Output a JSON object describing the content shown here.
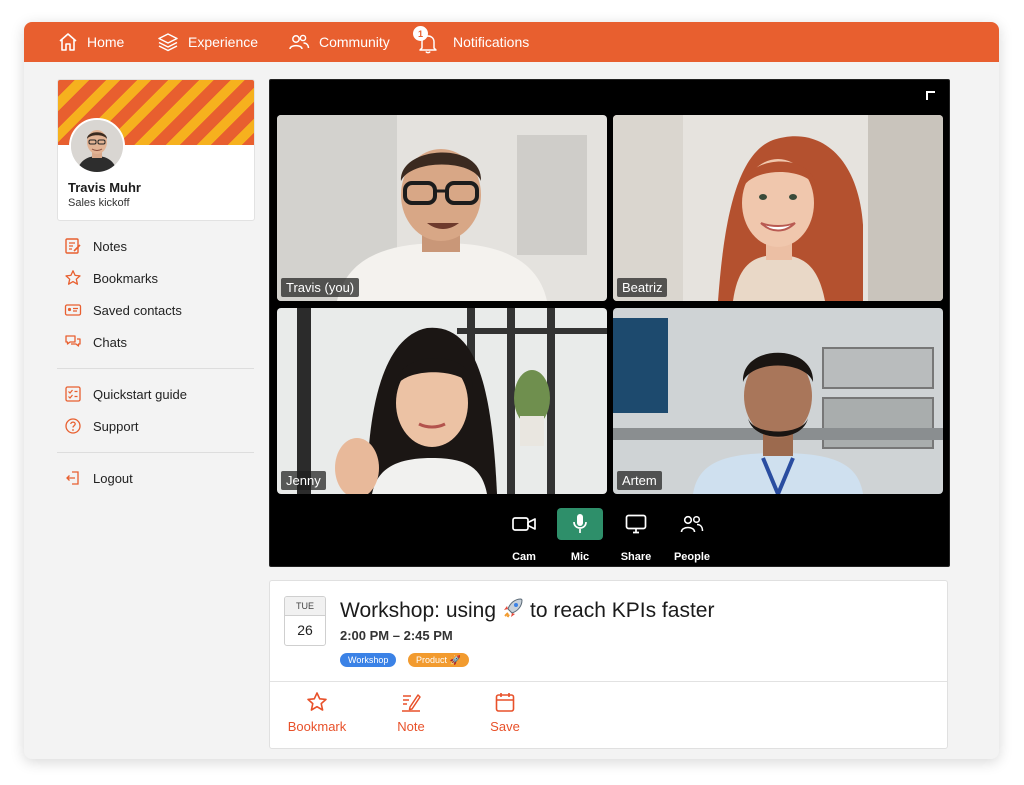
{
  "nav": {
    "items": [
      {
        "label": "Home",
        "icon": "home-icon"
      },
      {
        "label": "Experience",
        "icon": "layers-icon"
      },
      {
        "label": "Community",
        "icon": "people-icon"
      },
      {
        "label": "Notifications",
        "icon": "bell-icon",
        "badge": "1"
      }
    ]
  },
  "profile": {
    "name": "Travis Muhr",
    "subtitle": "Sales kickoff"
  },
  "sidebar": {
    "items": [
      {
        "label": "Notes",
        "icon": "notes-icon"
      },
      {
        "label": "Bookmarks",
        "icon": "star-icon"
      },
      {
        "label": "Saved contacts",
        "icon": "contact-card-icon"
      },
      {
        "label": "Chats",
        "icon": "chat-icon"
      },
      {
        "label": "Quickstart guide",
        "icon": "checklist-icon"
      },
      {
        "label": "Support",
        "icon": "help-icon"
      },
      {
        "label": "Logout",
        "icon": "logout-icon"
      }
    ]
  },
  "call": {
    "participants": [
      {
        "name": "Travis (you)"
      },
      {
        "name": "Beatriz"
      },
      {
        "name": "Jenny"
      },
      {
        "name": "Artem"
      }
    ],
    "controls": [
      {
        "label": "Cam",
        "icon": "camera-icon",
        "active": false
      },
      {
        "label": "Mic",
        "icon": "mic-icon",
        "active": true
      },
      {
        "label": "Share",
        "icon": "screen-share-icon",
        "active": false
      },
      {
        "label": "People",
        "icon": "people-icon",
        "active": false
      }
    ]
  },
  "event": {
    "dow": "TUE",
    "day": "26",
    "title_before": "Workshop: using",
    "title_emoji": "rocket-icon",
    "title_after": "to reach KPIs faster",
    "time": "2:00 PM – 2:45 PM",
    "tags": [
      {
        "label": "Workshop",
        "color": "#3b82e6"
      },
      {
        "label": "Product 🚀",
        "color": "#f29b2f"
      }
    ],
    "actions": [
      {
        "label": "Bookmark",
        "icon": "star-icon"
      },
      {
        "label": "Note",
        "icon": "note-edit-icon"
      },
      {
        "label": "Save",
        "icon": "calendar-icon"
      }
    ]
  },
  "colors": {
    "brand": "#e85f2f",
    "stripe": "#f6b11e",
    "mic_active": "#2e8f6a",
    "action": "#e8512a"
  }
}
